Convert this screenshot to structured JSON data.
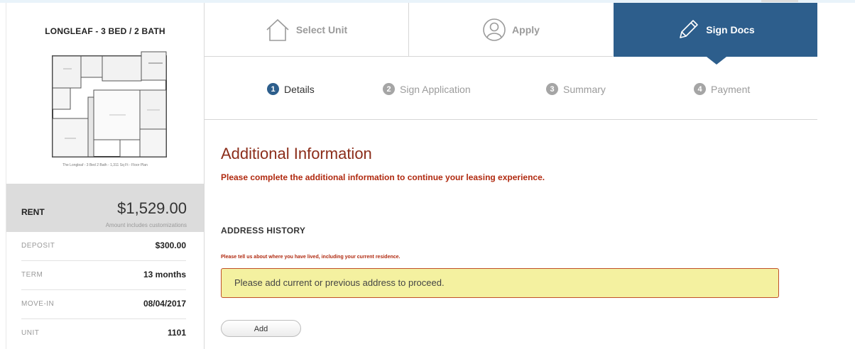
{
  "sidebar": {
    "plan_title": "LONGLEAF - 3 BED / 2 BATH",
    "floorplan_caption": "The Longleaf - 3 Bed 2 Bath - 1,311 Sq Ft - Floor Plan",
    "rent_label": "RENT",
    "rent_value": "$1,529.00",
    "rent_note": "Amount includes customizations",
    "details": [
      {
        "label": "DEPOSIT",
        "value": "$300.00"
      },
      {
        "label": "TERM",
        "value": "13 months"
      },
      {
        "label": "MOVE-IN",
        "value": "08/04/2017"
      },
      {
        "label": "UNIT",
        "value": "1101"
      }
    ]
  },
  "steps": [
    {
      "label": "Select Unit",
      "icon": "house-icon",
      "active": false
    },
    {
      "label": "Apply",
      "icon": "person-icon",
      "active": false
    },
    {
      "label": "Sign Docs",
      "icon": "pencil-icon",
      "active": true
    }
  ],
  "substeps": [
    {
      "num": "1",
      "label": "Details",
      "active": true
    },
    {
      "num": "2",
      "label": "Sign Application",
      "active": false
    },
    {
      "num": "3",
      "label": "Summary",
      "active": false
    },
    {
      "num": "4",
      "label": "Payment",
      "active": false
    }
  ],
  "main": {
    "title": "Additional Information",
    "subtitle": "Please complete the additional information to continue your leasing experience.",
    "section_title": "ADDRESS HISTORY",
    "section_desc": "Please tell us about where you have lived, including your current residence.",
    "warning": "Please add current or previous address to proceed.",
    "add_label": "Add"
  },
  "colors": {
    "accent": "#2d5e8c",
    "title_red": "#8b2d1a",
    "warning_bg": "#f4f1a0",
    "warning_border": "#c0502a"
  }
}
